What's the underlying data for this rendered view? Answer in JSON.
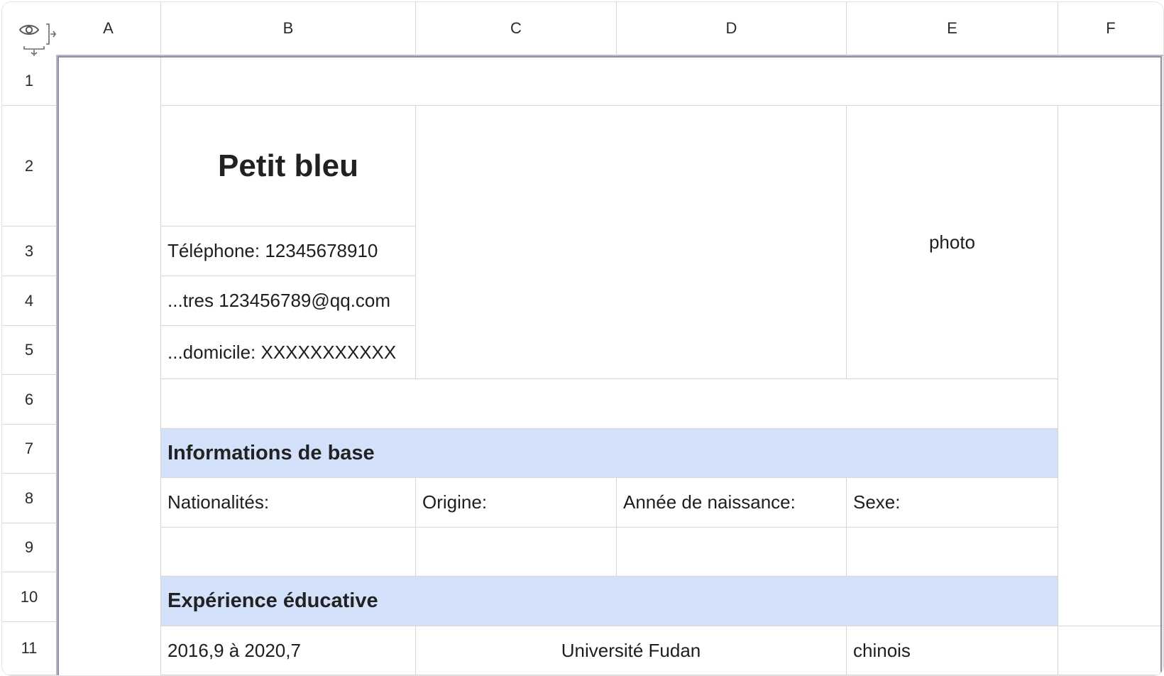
{
  "columns": [
    "A",
    "B",
    "C",
    "D",
    "E",
    "F"
  ],
  "rows": [
    "1",
    "2",
    "3",
    "4",
    "5",
    "6",
    "7",
    "8",
    "9",
    "10",
    "11"
  ],
  "corner_icons": [
    "eye-icon",
    "collapse-columns-icon",
    "collapse-rows-icon"
  ],
  "resume": {
    "name": "Petit bleu",
    "phone": "Téléphone: 12345678910",
    "email": "...tres 123456789@qq.com",
    "address": "...domicile: XXXXXXXXXXX",
    "photo": "photo"
  },
  "basic_info": {
    "heading": "Informations de base",
    "labels": [
      "Nationalités:",
      "Origine:",
      "Année de naissance:",
      "Sexe:"
    ]
  },
  "education": {
    "heading": "Expérience éducative",
    "period": "2016,9 à 2020,7",
    "school": "Université Fudan",
    "language": "chinois"
  },
  "colors": {
    "section_fill": "#d3e1fb",
    "grid_line": "#d6d6d6",
    "table_border": "#8f8fa8"
  }
}
